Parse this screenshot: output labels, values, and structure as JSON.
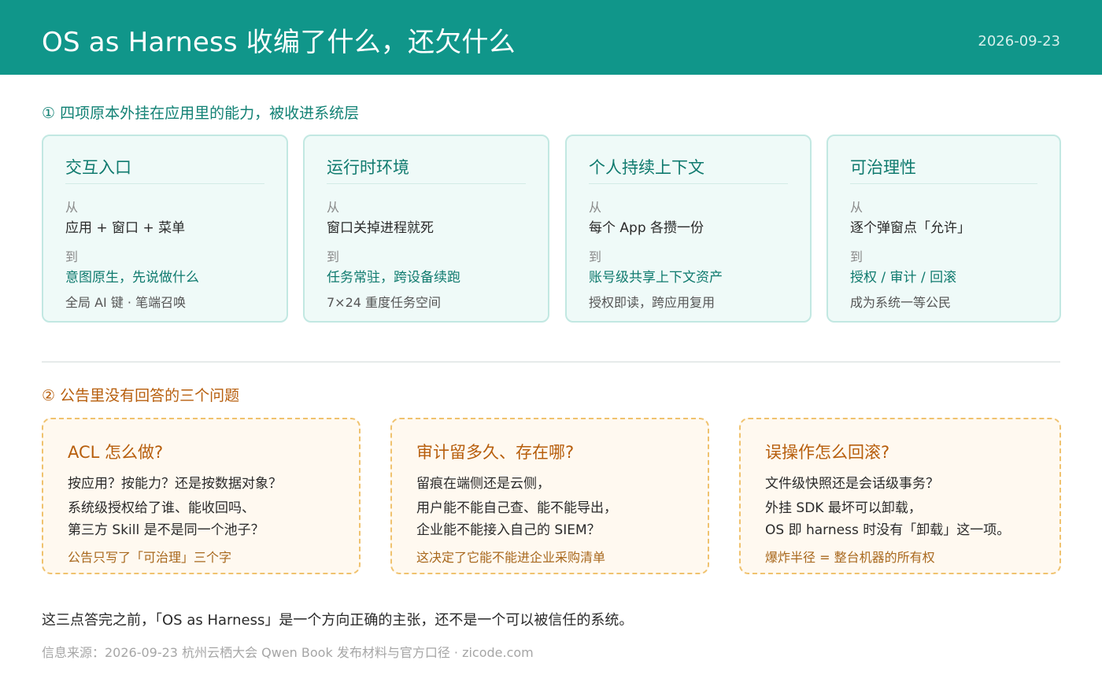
{
  "header": {
    "title": "OS as Harness 收编了什么，还欠什么",
    "date": "2026-09-23"
  },
  "section1": {
    "title": "① 四项原本外挂在应用里的能力，被收进系统层",
    "cards": [
      {
        "title": "交互入口",
        "from_label": "从",
        "from": "应用 + 窗口 + 菜单",
        "to_label": "到",
        "to": "意图原生，先说做什么",
        "note": "全局 AI 键 · 笔端召唤"
      },
      {
        "title": "运行时环境",
        "from_label": "从",
        "from": "窗口关掉进程就死",
        "to_label": "到",
        "to": "任务常驻，跨设备续跑",
        "note": "7×24 重度任务空间"
      },
      {
        "title": "个人持续上下文",
        "from_label": "从",
        "from": "每个 App 各攒一份",
        "to_label": "到",
        "to": "账号级共享上下文资产",
        "note": "授权即读，跨应用复用"
      },
      {
        "title": "可治理性",
        "from_label": "从",
        "from": "逐个弹窗点「允许」",
        "to_label": "到",
        "to": "授权 / 审计 / 回滚",
        "note": "成为系统一等公民"
      }
    ]
  },
  "section2": {
    "title": "② 公告里没有回答的三个问题",
    "questions": [
      {
        "title": "ACL 怎么做?",
        "lines": [
          "按应用？按能力？还是按数据对象？",
          "系统级授权给了谁、能收回吗、",
          "第三方 Skill 是不是同一个池子？"
        ],
        "note": "公告只写了「可治理」三个字"
      },
      {
        "title": "审计留多久、存在哪?",
        "lines": [
          "留痕在端侧还是云侧，",
          "用户能不能自己查、能不能导出，",
          "企业能不能接入自己的 SIEM？"
        ],
        "note": "这决定了它能不能进企业采购清单"
      },
      {
        "title": "误操作怎么回滚?",
        "lines": [
          "文件级快照还是会话级事务？",
          "外挂 SDK 最坏可以卸载，",
          "OS 即 harness 时没有「卸载」这一项。"
        ],
        "note": "爆炸半径 = 整台机器的所有权"
      }
    ]
  },
  "footer": {
    "conclusion": "这三点答完之前，「OS as Harness」是一个方向正确的主张，还不是一个可以被信任的系统。",
    "source": "信息来源：2026-09-23 杭州云栖大会 Qwen Book 发布材料与官方口径 · zicode.com"
  }
}
